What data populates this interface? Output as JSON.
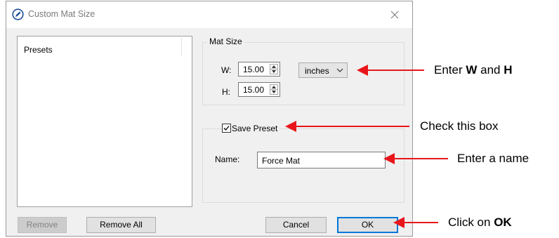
{
  "window": {
    "title": "Custom Mat Size",
    "icon": "pencil-circle-icon",
    "close_icon": "close-icon"
  },
  "presets": {
    "column_header": "Presets",
    "items": []
  },
  "mat_size": {
    "group_label": "Mat Size",
    "width_label": "W:",
    "width_value": "15.00",
    "height_label": "H:",
    "height_value": "15.00",
    "units_selected": "inches"
  },
  "save_preset": {
    "checkbox_label": "Save Preset",
    "checked": true,
    "name_label": "Name:",
    "name_value": "Force Mat"
  },
  "buttons": {
    "remove": "Remove",
    "remove_all": "Remove All",
    "cancel": "Cancel",
    "ok": "OK"
  },
  "annotations": {
    "enter_w_h": {
      "prefix": "Enter ",
      "w": "W",
      "middle": " and ",
      "h": "H"
    },
    "check_box": "Check this box",
    "enter_name": "Enter a name",
    "click_ok": {
      "prefix": "Click on ",
      "ok": "OK"
    }
  },
  "colors": {
    "arrow": "#e8161b",
    "dialog_bg": "#f0f0f0",
    "default_button_border": "#0078d7",
    "disabled_text": "#838383"
  }
}
